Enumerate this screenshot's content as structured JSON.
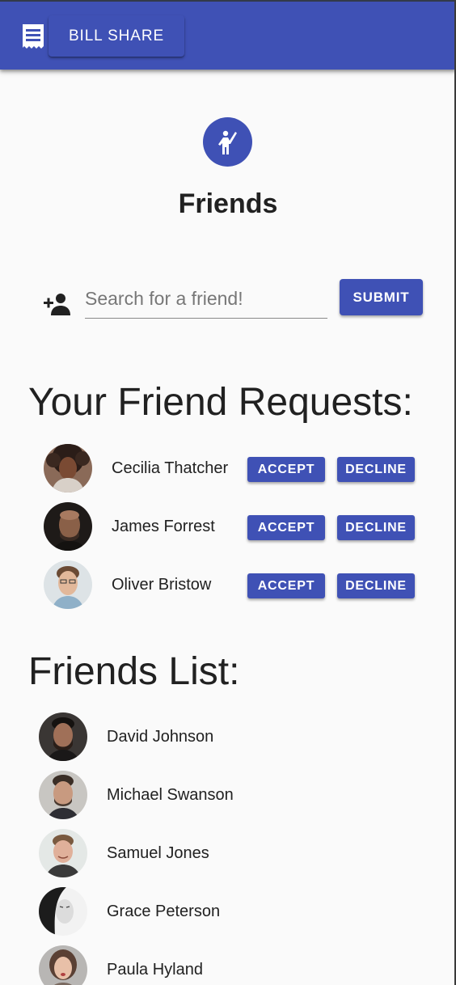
{
  "appbar": {
    "icon": "receipt-icon",
    "brand_label": "BILL SHARE",
    "color": "#3f51b5"
  },
  "header": {
    "icon": "person-waving-icon",
    "title": "Friends"
  },
  "search": {
    "icon": "person-add-icon",
    "placeholder": "Search for a friend!",
    "value": "",
    "submit_label": "SUBMIT"
  },
  "requests": {
    "heading": "Your Friend Requests:",
    "accept_label": "ACCEPT",
    "decline_label": "DECLINE",
    "items": [
      {
        "name": "Cecilia Thatcher"
      },
      {
        "name": "James Forrest"
      },
      {
        "name": "Oliver Bristow"
      }
    ]
  },
  "friends": {
    "heading": "Friends List:",
    "items": [
      {
        "name": "David Johnson"
      },
      {
        "name": "Michael Swanson"
      },
      {
        "name": "Samuel Jones"
      },
      {
        "name": "Grace Peterson"
      },
      {
        "name": "Paula Hyland"
      }
    ]
  },
  "colors": {
    "accent": "#3f51b5",
    "background": "#fafafa",
    "text": "#212121"
  }
}
